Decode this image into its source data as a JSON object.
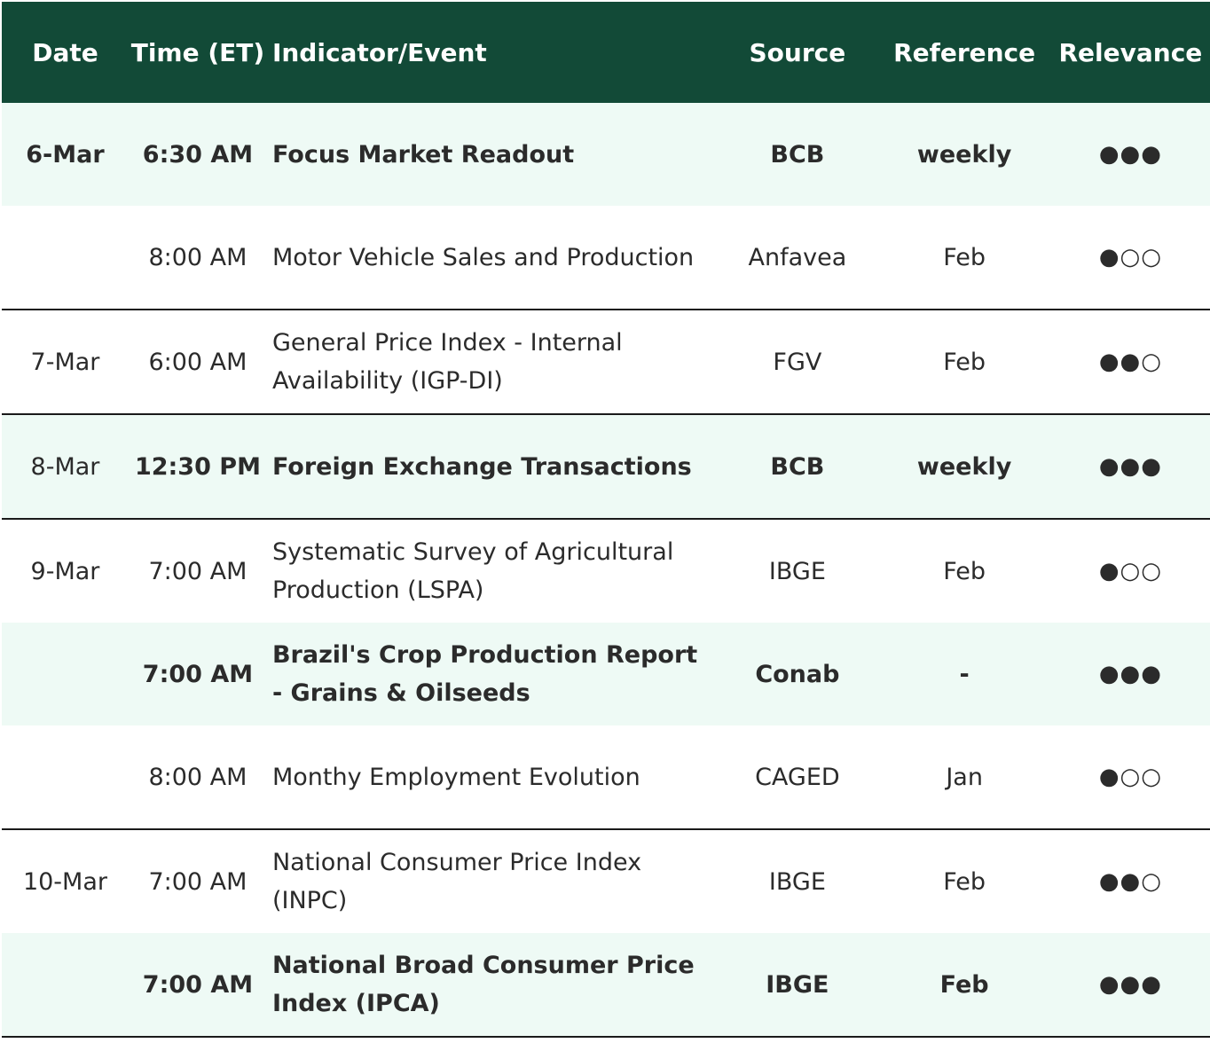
{
  "header": {
    "date": "Date",
    "time": "Time (ET)",
    "event": "Indicator/Event",
    "source": "Source",
    "reference": "Reference",
    "relevance": "Relevance"
  },
  "colors": {
    "header_bg": "#124a37",
    "highlight_row_bg": "#eefaf5"
  },
  "rows": [
    {
      "date": "6-Mar",
      "time": "6:30 AM",
      "event": "Focus Market Readout",
      "source": "BCB",
      "reference": "weekly",
      "relevance": "●●●"
    },
    {
      "date": "",
      "time": "8:00 AM",
      "event": "Motor Vehicle Sales and Production",
      "source": "Anfavea",
      "reference": "Feb",
      "relevance": "●○○"
    },
    {
      "date": "7-Mar",
      "time": "6:00 AM",
      "event": "General Price Index - Internal Availability (IGP-DI)",
      "source": "FGV",
      "reference": "Feb",
      "relevance": "●●○"
    },
    {
      "date": "8-Mar",
      "time": "12:30 PM",
      "event": "Foreign Exchange Transactions",
      "source": "BCB",
      "reference": "weekly",
      "relevance": "●●●"
    },
    {
      "date": "9-Mar",
      "time": "7:00 AM",
      "event": "Systematic Survey of Agricultural Production (LSPA)",
      "source": "IBGE",
      "reference": "Feb",
      "relevance": "●○○"
    },
    {
      "date": "",
      "time": "7:00 AM",
      "event": "Brazil's Crop Production Report - Grains & Oilseeds",
      "source": "Conab",
      "reference": "-",
      "relevance": "●●●"
    },
    {
      "date": "",
      "time": "8:00 AM",
      "event": "Monthy Employment Evolution",
      "source": "CAGED",
      "reference": "Jan",
      "relevance": "●○○"
    },
    {
      "date": "10-Mar",
      "time": "7:00 AM",
      "event": "National Consumer Price Index (INPC)",
      "source": "IBGE",
      "reference": "Feb",
      "relevance": "●●○"
    },
    {
      "date": "",
      "time": "7:00 AM",
      "event": "National Broad Consumer Price Index (IPCA)",
      "source": "IBGE",
      "reference": "Feb",
      "relevance": "●●●"
    }
  ]
}
